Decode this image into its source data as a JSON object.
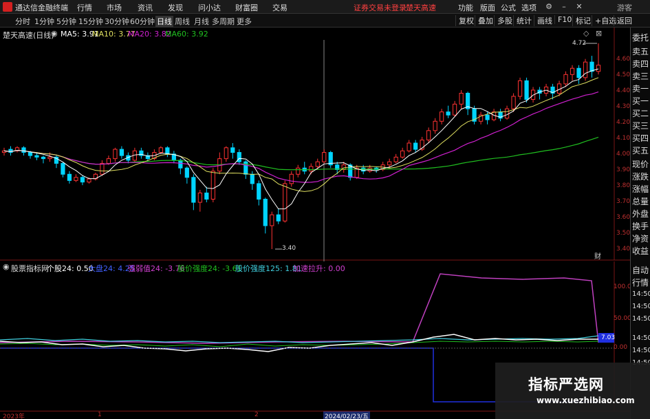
{
  "menubar": {
    "app_title": "通达信金融终端",
    "items": [
      "行情",
      "市场",
      "资讯",
      "发现",
      "问小达",
      "财富圈",
      "交易"
    ],
    "warning1": "证券交易未登录",
    "warning2": "楚天高速",
    "right_items": [
      "功能",
      "版面",
      "公式",
      "选项"
    ],
    "user": "游客"
  },
  "toolbar": {
    "periods": [
      "分时",
      "1分钟",
      "5分钟",
      "15分钟",
      "30分钟",
      "60分钟",
      "日线",
      "周线",
      "月线",
      "多周期",
      "更多"
    ],
    "tools": [
      "复权",
      "叠加",
      "多股",
      "统计",
      "画线",
      "F10",
      "标记",
      "+自选",
      "返回"
    ]
  },
  "sidepanel": {
    "items": [
      "委托",
      "卖五",
      "卖四",
      "卖三",
      "卖一",
      "买一",
      "买二",
      "买三",
      "买四",
      "买五",
      "现价",
      "涨跌",
      "涨幅",
      "总量",
      "外盘",
      "换手",
      "净资",
      "收益",
      "自动",
      "行情",
      "14:50",
      "14:50",
      "14:50",
      "14:50",
      "14:50",
      "14:50"
    ]
  },
  "price_panel": {
    "title": "楚天高速(日线)",
    "ma5": "MA5: 3.91",
    "ma10": "MA10: 3.77",
    "ma20": "MA20: 3.82",
    "ma60": "MA60: 3.92",
    "high_label": "4.72",
    "low_label": "3.40",
    "y_ticks": [
      "4.60",
      "4.50",
      "4.40",
      "4.30",
      "4.20",
      "4.10",
      "4.00",
      "3.90",
      "3.80",
      "3.70",
      "3.60",
      "3.50",
      "3.40"
    ],
    "corner": "财"
  },
  "indicator_panel": {
    "title": "股票指标网",
    "g1": "个股24: 0.50",
    "g2": "大盘24: 4.25",
    "g3": "强弱值24: -3.76",
    "g4": "股价强度24: -3.61",
    "g5": "股价强度125: 1.81",
    "g6": "加速拉升: 0.00",
    "y_ticks": [
      "100.0",
      "50.00",
      "0.00"
    ],
    "cur_value": "7.03"
  },
  "time_axis": {
    "labels": [
      "2023年",
      "1",
      "2",
      "2024/02/23/五"
    ]
  },
  "watermark": {
    "cn": "指标严选网",
    "url": "www.xuezhibiao.com"
  },
  "colors": {
    "up": "#ff3232",
    "down": "#00d4ff",
    "ma5": "#ffffff",
    "ma10": "#e0e060",
    "ma20": "#d020d0",
    "ma60": "#20c020"
  },
  "chart_data": {
    "type": "candlestick",
    "ylim": [
      3.4,
      4.72
    ],
    "ohlc": [
      [
        4.02,
        4.03,
        4.0,
        4.05
      ],
      [
        4.04,
        4.02,
        4.0,
        4.06
      ],
      [
        4.03,
        4.05,
        4.02,
        4.06
      ],
      [
        4.05,
        4.02,
        4.0,
        4.06
      ],
      [
        4.02,
        4.0,
        3.98,
        4.03
      ],
      [
        4.0,
        3.99,
        3.97,
        4.02
      ],
      [
        3.99,
        3.98,
        3.95,
        4.0
      ],
      [
        3.98,
        3.99,
        3.96,
        4.02
      ],
      [
        3.99,
        3.95,
        3.92,
        4.0
      ],
      [
        3.95,
        3.88,
        3.86,
        3.96
      ],
      [
        3.88,
        3.84,
        3.82,
        3.9
      ],
      [
        3.84,
        3.86,
        3.83,
        3.88
      ],
      [
        3.86,
        3.83,
        3.81,
        3.87
      ],
      [
        3.83,
        3.85,
        3.82,
        3.86
      ],
      [
        3.85,
        3.88,
        3.84,
        3.89
      ],
      [
        3.88,
        3.95,
        3.87,
        3.97
      ],
      [
        3.95,
        3.98,
        3.94,
        4.0
      ],
      [
        3.98,
        4.04,
        3.96,
        4.05
      ],
      [
        4.04,
        4.0,
        3.98,
        4.06
      ],
      [
        4.0,
        3.97,
        3.95,
        4.02
      ],
      [
        3.97,
        4.03,
        3.96,
        4.05
      ],
      [
        4.03,
        4.0,
        3.98,
        4.05
      ],
      [
        4.0,
        3.98,
        3.96,
        4.02
      ],
      [
        3.98,
        4.02,
        3.97,
        4.04
      ],
      [
        4.02,
        4.05,
        4.01,
        4.06
      ],
      [
        4.05,
        4.01,
        3.99,
        4.06
      ],
      [
        4.01,
        3.97,
        3.95,
        4.03
      ],
      [
        3.97,
        3.92,
        3.88,
        3.98
      ],
      [
        3.92,
        3.86,
        3.82,
        3.93
      ],
      [
        3.86,
        3.7,
        3.65,
        3.88
      ],
      [
        3.7,
        3.76,
        3.64,
        3.78
      ],
      [
        3.76,
        3.72,
        3.7,
        3.8
      ],
      [
        3.72,
        3.9,
        3.7,
        3.92
      ],
      [
        3.9,
        3.98,
        3.88,
        4.02
      ],
      [
        3.98,
        4.05,
        3.96,
        4.06
      ],
      [
        4.05,
        4.02,
        3.98,
        4.08
      ],
      [
        4.02,
        3.96,
        3.94,
        4.04
      ],
      [
        3.96,
        3.88,
        3.85,
        3.97
      ],
      [
        3.88,
        3.82,
        3.78,
        3.9
      ],
      [
        3.82,
        3.72,
        3.68,
        3.84
      ],
      [
        3.72,
        3.55,
        3.5,
        3.73
      ],
      [
        3.55,
        3.62,
        3.4,
        3.64
      ],
      [
        3.62,
        3.58,
        3.56,
        3.66
      ],
      [
        3.58,
        3.82,
        3.57,
        3.84
      ],
      [
        3.82,
        3.88,
        3.8,
        3.9
      ],
      [
        3.88,
        3.92,
        3.86,
        3.94
      ],
      [
        3.92,
        3.9,
        3.88,
        3.96
      ],
      [
        3.9,
        3.93,
        3.88,
        3.95
      ],
      [
        3.93,
        3.96,
        3.91,
        3.98
      ],
      [
        3.96,
        4.02,
        3.95,
        4.04
      ],
      [
        4.02,
        3.94,
        3.92,
        4.03
      ],
      [
        3.94,
        3.91,
        3.88,
        3.96
      ],
      [
        3.91,
        3.94,
        3.89,
        3.96
      ],
      [
        3.94,
        3.86,
        3.84,
        3.95
      ],
      [
        3.86,
        3.92,
        3.85,
        3.94
      ],
      [
        3.92,
        3.9,
        3.88,
        3.94
      ],
      [
        3.9,
        3.92,
        3.89,
        3.94
      ],
      [
        3.92,
        3.91,
        3.89,
        3.93
      ],
      [
        3.91,
        3.94,
        3.9,
        3.96
      ],
      [
        3.94,
        3.96,
        3.92,
        3.98
      ],
      [
        3.96,
        3.99,
        3.95,
        4.01
      ],
      [
        3.99,
        4.03,
        3.98,
        4.05
      ],
      [
        4.03,
        4.08,
        4.02,
        4.1
      ],
      [
        4.08,
        4.04,
        4.02,
        4.1
      ],
      [
        4.04,
        4.1,
        4.03,
        4.12
      ],
      [
        4.1,
        4.16,
        4.08,
        4.18
      ],
      [
        4.16,
        4.22,
        4.14,
        4.24
      ],
      [
        4.22,
        4.28,
        4.2,
        4.3
      ],
      [
        4.28,
        4.26,
        4.24,
        4.32
      ],
      [
        4.26,
        4.33,
        4.25,
        4.35
      ],
      [
        4.33,
        4.4,
        4.3,
        4.42
      ],
      [
        4.4,
        4.3,
        4.26,
        4.41
      ],
      [
        4.3,
        4.22,
        4.2,
        4.32
      ],
      [
        4.22,
        4.26,
        4.2,
        4.28
      ],
      [
        4.26,
        4.23,
        4.2,
        4.28
      ],
      [
        4.23,
        4.28,
        4.22,
        4.3
      ],
      [
        4.28,
        4.24,
        4.22,
        4.3
      ],
      [
        4.24,
        4.3,
        4.23,
        4.32
      ],
      [
        4.3,
        4.38,
        4.28,
        4.4
      ],
      [
        4.38,
        4.48,
        4.36,
        4.5
      ],
      [
        4.48,
        4.36,
        4.34,
        4.5
      ],
      [
        4.36,
        4.42,
        4.34,
        4.44
      ],
      [
        4.42,
        4.4,
        4.36,
        4.44
      ],
      [
        4.4,
        4.44,
        4.38,
        4.46
      ],
      [
        4.44,
        4.4,
        4.36,
        4.46
      ],
      [
        4.4,
        4.46,
        4.38,
        4.48
      ],
      [
        4.46,
        4.52,
        4.44,
        4.54
      ],
      [
        4.52,
        4.56,
        4.48,
        4.58
      ],
      [
        4.56,
        4.5,
        4.46,
        4.58
      ],
      [
        4.5,
        4.6,
        4.48,
        4.62
      ],
      [
        4.6,
        4.54,
        4.5,
        4.64
      ],
      [
        4.54,
        4.58,
        4.52,
        4.72
      ]
    ]
  }
}
